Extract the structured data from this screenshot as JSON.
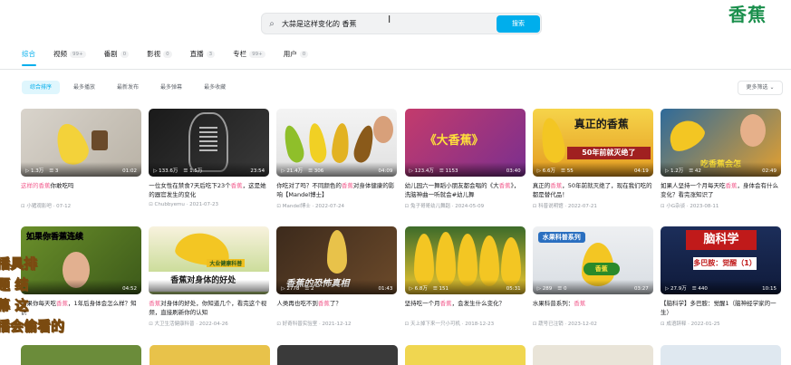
{
  "search": {
    "query": "大蒜是这样变化的 香蕉",
    "button_label": "搜索"
  },
  "brand_logo_text": "香蕉",
  "tabs": [
    {
      "label": "综合",
      "count": ""
    },
    {
      "label": "视频",
      "count": "99+"
    },
    {
      "label": "番剧",
      "count": "0"
    },
    {
      "label": "影视",
      "count": "0"
    },
    {
      "label": "直播",
      "count": "3"
    },
    {
      "label": "专栏",
      "count": "99+"
    },
    {
      "label": "用户",
      "count": "0"
    }
  ],
  "filters": [
    "综合排序",
    "最多播放",
    "最新发布",
    "最多弹幕",
    "最多收藏"
  ],
  "more_filter_label": "更多筛选 ⌄",
  "videos": [
    {
      "plays": "1.3万",
      "danmaku": "3",
      "duration": "01:02",
      "title_hl": "这样的香蕉",
      "title_rest": "你敢吃吗",
      "meta": "小猪观影吧 · 07-12",
      "thumb_text": ""
    },
    {
      "plays": "133.6万",
      "danmaku": "1.5万",
      "duration": "23:54",
      "title_pre": "一位女性在禁食7天后吃下23个",
      "title_hl": "香蕉",
      "title_rest": "，这是她的器官发生的变化",
      "meta": "Chubbyemu · 2021-07-23",
      "thumb_text": ""
    },
    {
      "plays": "21.4万",
      "danmaku": "306",
      "duration": "04:09",
      "title_pre": "你吃对了吗？不同颜色的",
      "title_hl": "香蕉",
      "title_rest": "对身体健康的影响【Mandel博士】",
      "meta": "Mandel博士 · 2022-07-24",
      "thumb_text": ""
    },
    {
      "plays": "123.4万",
      "danmaku": "1153",
      "duration": "03:40",
      "title_pre": "幼儿园六一舞蹈小朋友都会唱的《大",
      "title_hl": "香蕉",
      "title_rest": "》，洗脑神曲一听就会#幼儿舞",
      "meta": "兔子哥哥幼儿舞蹈 · 2024-05-09",
      "thumb_text": "《大香蕉》"
    },
    {
      "plays": "6.6万",
      "danmaku": "55",
      "duration": "04:19",
      "title_pre": "真正的",
      "title_hl": "香蕉",
      "title_rest": "，50年前就灭绝了，现在我们吃的都是替代品！",
      "meta": "科普说明馆 · 2022-07-21",
      "thumb_text": "真正的香蕉"
    },
    {
      "plays": "1.2万",
      "danmaku": "42",
      "duration": "02:49",
      "title_pre": "如果人坚持一个月每天吃",
      "title_hl": "香蕉",
      "title_rest": "，身体会有什么变化？看完涨知识了",
      "meta": "小G杂谈 · 2023-08-11",
      "thumb_text": "吃香蕉会怎"
    },
    {
      "plays": "",
      "danmaku": "",
      "duration": "04:52",
      "title_pre": "如果你每天吃",
      "title_hl": "香蕉",
      "title_rest": "，1年后身体会怎么样？知识",
      "meta": "",
      "thumb_text": "如果你香蕉连续"
    },
    {
      "plays": "",
      "danmaku": "",
      "duration": "",
      "title_pre": "",
      "title_hl": "香蕉",
      "title_rest": "对身体的好处，你知道几个，看完这个视频，直接刷新你的认知",
      "meta": "大卫生活健康科普 · 2022-04-26",
      "thumb_text": "香蕉对身体的好处"
    },
    {
      "plays": "2778",
      "danmaku": "2",
      "duration": "01:43",
      "title_pre": "人类再也吃不到",
      "title_hl": "香蕉",
      "title_rest": "了？",
      "meta": "好奇科普实验室 · 2021-12-12",
      "thumb_text": "香蕉的恐怖真相"
    },
    {
      "plays": "6.8万",
      "danmaku": "151",
      "duration": "05:31",
      "title_pre": "坚持吃一个月",
      "title_hl": "香蕉",
      "title_rest": "，会发生什么变化？",
      "meta": "天上掉下来一只小可机 · 2018-12-23",
      "thumb_text": ""
    },
    {
      "plays": "289",
      "danmaku": "0",
      "duration": "03:27",
      "title_pre": "水果科普系列：",
      "title_hl": "香蕉",
      "title_rest": "",
      "meta": "蔬号已注销 · 2023-12-02",
      "thumb_text": "水果科普系列"
    },
    {
      "plays": "27.9万",
      "danmaku": "440",
      "duration": "10:15",
      "title_pre": "【脑科学】多巴胺：觉醒1（脑神经学家的一生）",
      "title_hl": "",
      "title_rest": "",
      "meta": "成语辞释 · 2022-01-25",
      "thumb_text": "脑科学"
    }
  ],
  "subtitle_lines": [
    "播具排",
    "题 结",
    "幕 这",
    "播会偷看的"
  ]
}
